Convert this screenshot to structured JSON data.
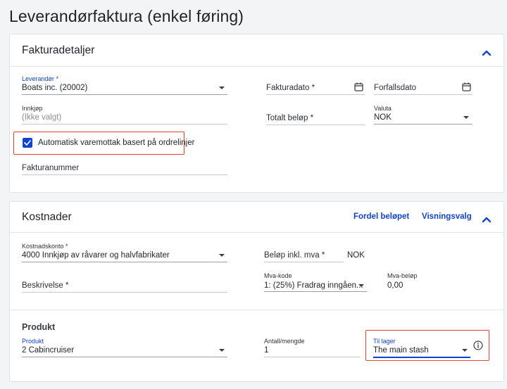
{
  "page": {
    "title": "Leverandørfaktura (enkel føring)"
  },
  "invoice_details": {
    "title": "Fakturadetaljer",
    "supplier": {
      "label": "Leverandør *",
      "value": "Boats inc. (20002)"
    },
    "purchase": {
      "label": "Innkjøp",
      "value": "(Ikke valgt)"
    },
    "auto_receipt": {
      "label": "Automatisk varemottak basert på ordrelinjer",
      "checked": true
    },
    "invoice_number": {
      "placeholder": "Fakturanummer"
    },
    "invoice_date": {
      "placeholder": "Fakturadato *"
    },
    "due_date": {
      "placeholder": "Forfallsdato"
    },
    "total_amount": {
      "placeholder": "Totalt beløp *"
    },
    "currency": {
      "label": "Valuta",
      "value": "NOK"
    }
  },
  "costs": {
    "title": "Kostnader",
    "distribute_label": "Fordel beløpet",
    "view_options_label": "Visningsvalg",
    "cost_account": {
      "label": "Kostnadskonto *",
      "value": "4000 Innkjøp av råvarer og halvfabrikater"
    },
    "amount_incl_vat": {
      "placeholder": "Beløp inkl. mva *",
      "unit": "NOK"
    },
    "description": {
      "placeholder": "Beskrivelse *"
    },
    "vat_code": {
      "label": "Mva-kode",
      "value": "1: (25%) Fradrag inngåen..."
    },
    "vat_amount": {
      "label": "Mva-beløp",
      "value": "0,00"
    }
  },
  "product": {
    "title": "Produkt",
    "product_field": {
      "label": "Produkt",
      "value": "2 Cabincruiser"
    },
    "quantity": {
      "label": "Antall/mengde",
      "value": "1"
    },
    "to_stock": {
      "label": "Til lager",
      "value": "The main stash"
    }
  },
  "colors": {
    "accent": "#1144cc",
    "highlight": "#e0462f"
  }
}
